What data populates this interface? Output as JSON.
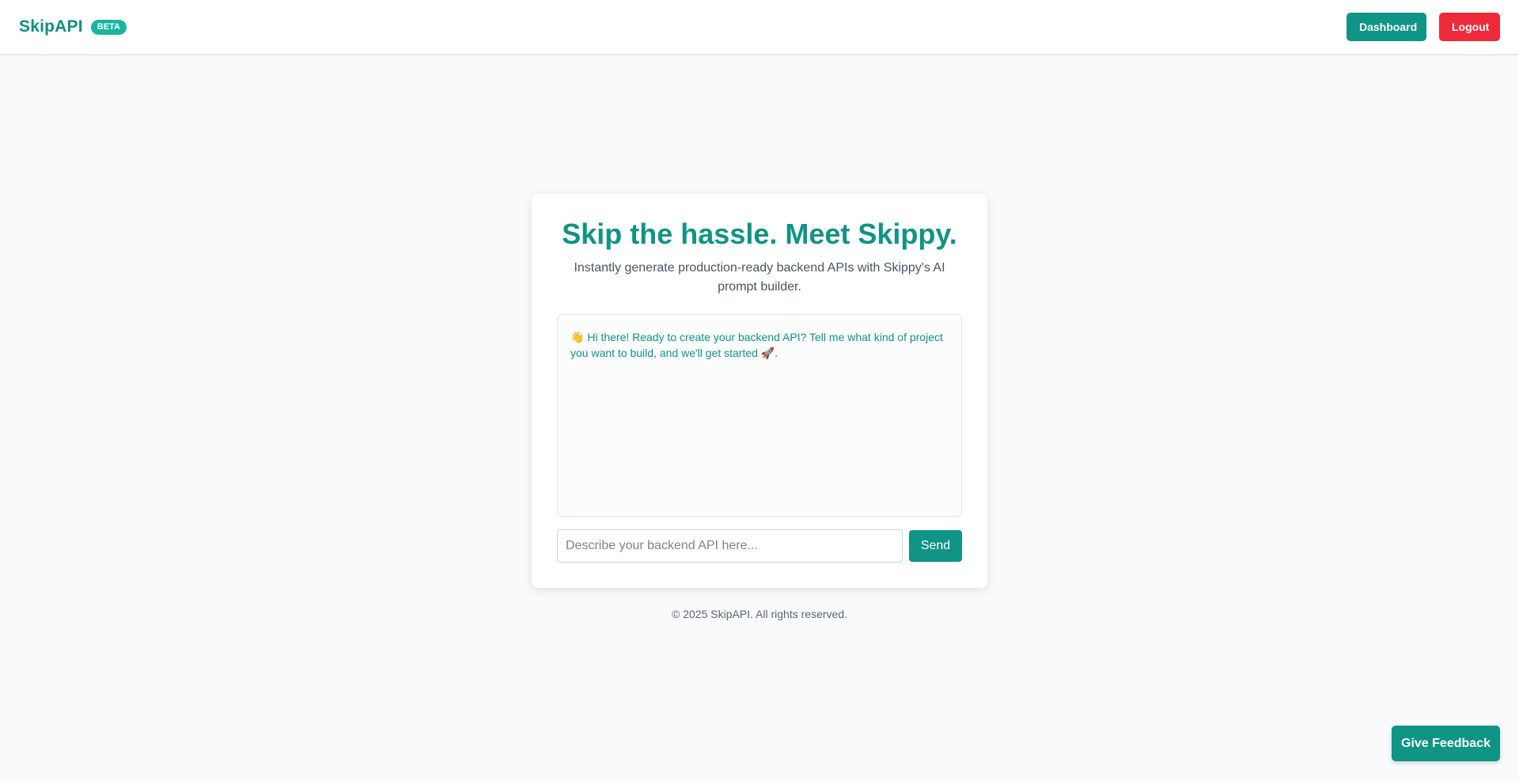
{
  "header": {
    "brand_name": "SkipAPI",
    "badge": "BETA",
    "dashboard_label": "Dashboard",
    "logout_label": "Logout"
  },
  "card": {
    "title": "Skip the hassle. Meet Skippy.",
    "subtitle": "Instantly generate production-ready backend APIs with Skippy's AI prompt builder.",
    "chat": {
      "greeting_emoji": "👋",
      "message": "Hi there! Ready to create your backend API? Tell me what kind of project you want to build, and we'll get started",
      "trailing_emoji": "🚀",
      "trailing_punct": "."
    },
    "input": {
      "placeholder": "Describe your backend API here...",
      "value": ""
    },
    "send_label": "Send"
  },
  "footer": {
    "copyright": "© 2025 SkipAPI. All rights reserved."
  },
  "feedback": {
    "label": "Give Feedback"
  },
  "colors": {
    "brand": "#0f9485",
    "logout": "#ee2a3a",
    "badge": "#18b6a0",
    "background": "#f8fafb"
  }
}
